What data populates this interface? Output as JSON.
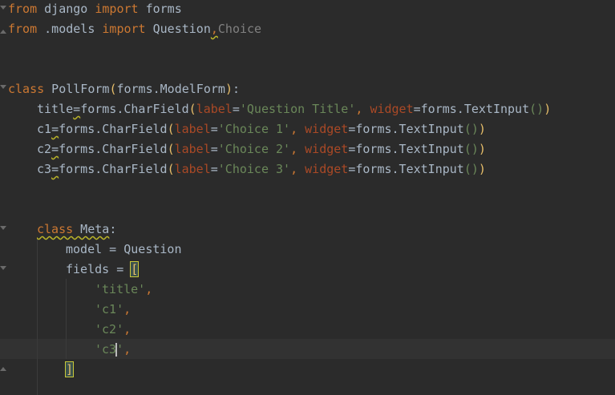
{
  "code": {
    "lines": {
      "l1": {
        "from": "from",
        "mod": " django ",
        "import": "import",
        "name": " forms"
      },
      "l2": {
        "from": "from",
        "mod": " .models ",
        "import": "import",
        "name1": " Question",
        "comma": ",",
        "name2": "Choice"
      },
      "l3": {
        "class": "class",
        "name": " PollForm",
        "open": "(",
        "base": "forms.ModelForm",
        "close": ")",
        "colon": ":"
      },
      "l4": {
        "field": "title",
        "eq": "=",
        "call": "forms.CharField",
        "open": "(",
        "kw1": "label",
        "eq1": "=",
        "val1": "'Question Title'",
        "sep": ", ",
        "kw2": "widget",
        "eq2": "=",
        "w": "forms.TextInput",
        "wp": "()",
        "close": ")"
      },
      "l5": {
        "field": "c1",
        "eq": "=",
        "call": "forms.CharField",
        "open": "(",
        "kw1": "label",
        "eq1": "=",
        "val1": "'Choice 1'",
        "sep": ", ",
        "kw2": "widget",
        "eq2": "=",
        "w": "forms.TextInput",
        "wp": "()",
        "close": ")"
      },
      "l6": {
        "field": "c2",
        "eq": "=",
        "call": "forms.CharField",
        "open": "(",
        "kw1": "label",
        "eq1": "=",
        "val1": "'Choice 2'",
        "sep": ", ",
        "kw2": "widget",
        "eq2": "=",
        "w": "forms.TextInput",
        "wp": "()",
        "close": ")"
      },
      "l7": {
        "field": "c3",
        "eq": "=",
        "call": "forms.CharField",
        "open": "(",
        "kw1": "label",
        "eq1": "=",
        "val1": "'Choice 3'",
        "sep": ", ",
        "kw2": "widget",
        "eq2": "=",
        "w": "forms.TextInput",
        "wp": "()",
        "close": ")"
      },
      "l8": {
        "class": "class",
        "name": " Meta",
        "colon": ":"
      },
      "l9": {
        "text": "model = Question"
      },
      "l10": {
        "text": "fields = ",
        "bracket": "["
      },
      "l11": {
        "str": "'title'",
        "comma": ","
      },
      "l12": {
        "str": "'c1'",
        "comma": ","
      },
      "l13": {
        "str": "'c2'",
        "comma": ","
      },
      "l14": {
        "str_a": "'c3",
        "str_b": "'",
        "comma": ","
      },
      "l15": {
        "bracket": "]"
      }
    }
  }
}
